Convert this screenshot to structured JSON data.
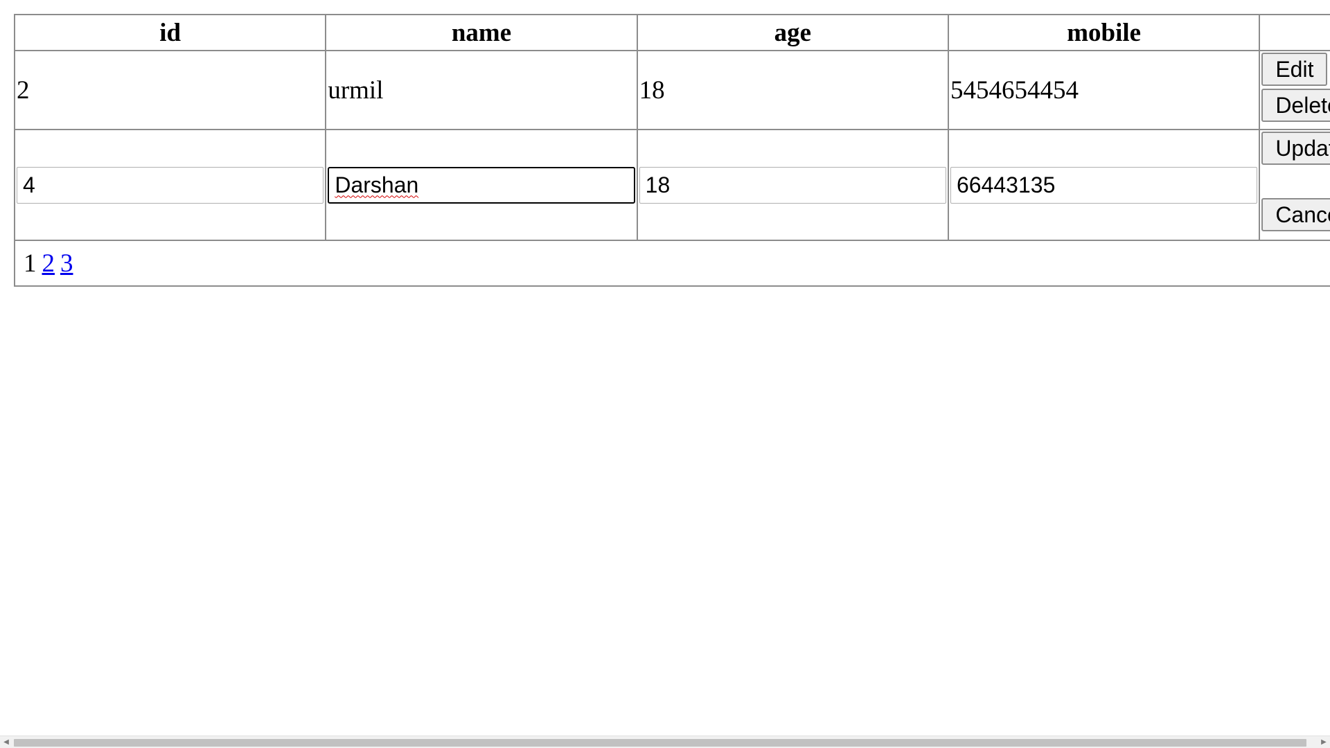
{
  "table": {
    "headers": [
      "id",
      "name",
      "age",
      "mobile",
      ""
    ],
    "view_row": {
      "id": "2",
      "name": "urmil",
      "age": "18",
      "mobile": "5454654454",
      "edit_label": "Edit",
      "delete_label": "Delete"
    },
    "edit_row": {
      "id": "4",
      "name": "Darshan",
      "age": "18",
      "mobile": "66443135",
      "update_label": "Update",
      "cancel_label": "Cancel"
    },
    "pager": {
      "current": "1",
      "pages": [
        "2",
        "3"
      ]
    }
  },
  "scrollbar": {
    "left_arrow": "◀",
    "right_arrow": "▶"
  }
}
